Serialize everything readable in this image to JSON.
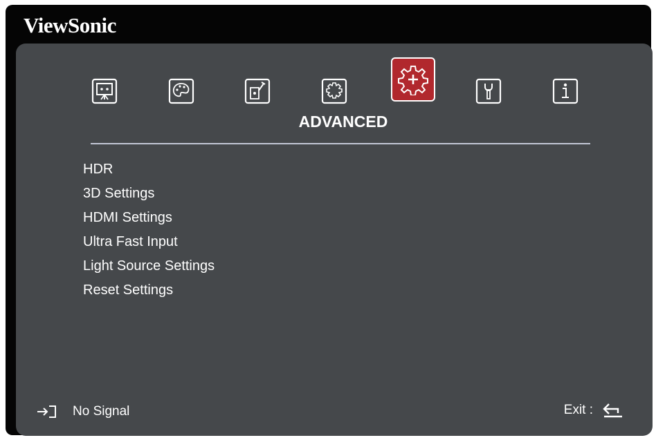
{
  "brand": "ViewSonic",
  "section_title": "ADVANCED",
  "tabs": [
    {
      "icon": "display-icon",
      "active": false
    },
    {
      "icon": "picture-palette-icon",
      "active": false
    },
    {
      "icon": "audio-settings-icon",
      "active": false
    },
    {
      "icon": "basic-gear-icon",
      "active": false
    },
    {
      "icon": "advanced-gear-icon",
      "active": true
    },
    {
      "icon": "system-wrench-icon",
      "active": false
    },
    {
      "icon": "information-icon",
      "active": false
    }
  ],
  "menu": {
    "items": [
      "HDR",
      "3D Settings",
      "HDMI Settings",
      "Ultra Fast Input",
      "Light Source Settings",
      "Reset Settings"
    ]
  },
  "footer": {
    "status": "No Signal",
    "exit_label": "Exit :"
  },
  "colors": {
    "background": "#050505",
    "panel": "#45484b",
    "active_tab": "#b1282d",
    "text": "#ffffff"
  }
}
